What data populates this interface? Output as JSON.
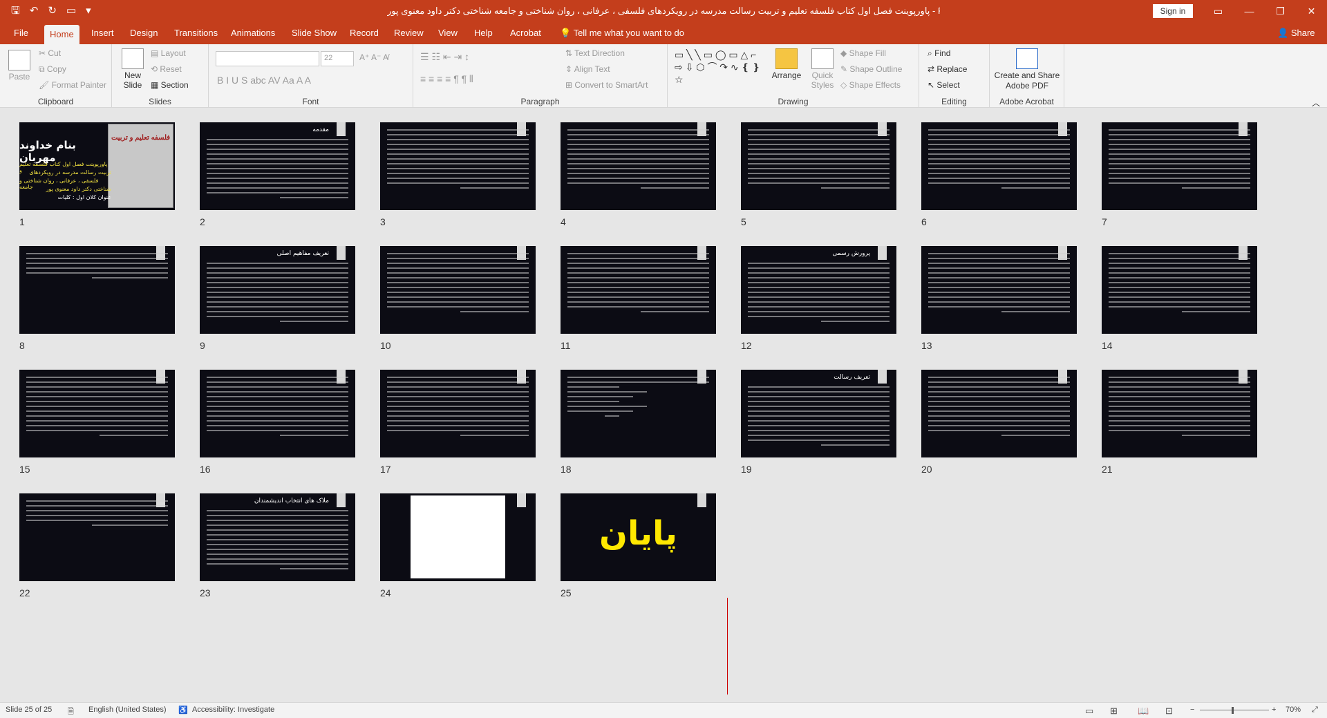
{
  "app": {
    "title": "پاورپوینت فصل اول کتاب فلسفه تعلیم و تربیت رسالت مدرسه در رویکردهای فلسفی ، عرفانی ، روان شناختی و جامعه شناختی دکتر داود معنوی پور  -  PowerPoint",
    "sign_in": "Sign in"
  },
  "menu": {
    "tabs": [
      "File",
      "Home",
      "Insert",
      "Design",
      "Transitions",
      "Animations",
      "Slide Show",
      "Record",
      "Review",
      "View",
      "Help",
      "Acrobat"
    ],
    "active": "Home",
    "tell_me": "Tell me what you want to do",
    "share": "Share"
  },
  "ribbon": {
    "clipboard": {
      "label": "Clipboard",
      "paste": "Paste",
      "cut": "Cut",
      "copy": "Copy",
      "format_painter": "Format Painter"
    },
    "slides": {
      "label": "Slides",
      "new_slide": "New Slide",
      "layout": "Layout",
      "reset": "Reset",
      "section": "Section"
    },
    "font": {
      "label": "Font",
      "size": "22"
    },
    "paragraph": {
      "label": "Paragraph",
      "text_direction": "Text Direction",
      "align_text": "Align Text",
      "convert_smartart": "Convert to SmartArt"
    },
    "drawing": {
      "label": "Drawing",
      "arrange": "Arrange",
      "quick_styles": "Quick Styles",
      "shape_fill": "Shape Fill",
      "shape_outline": "Shape Outline",
      "shape_effects": "Shape Effects"
    },
    "editing": {
      "label": "Editing",
      "find": "Find",
      "replace": "Replace",
      "select": "Select"
    },
    "acrobat": {
      "label": "Adobe Acrobat",
      "create_share": "Create and Share Adobe PDF"
    }
  },
  "slides": {
    "numbers": [
      "1",
      "2",
      "3",
      "4",
      "5",
      "6",
      "7",
      "8",
      "9",
      "10",
      "11",
      "12",
      "13",
      "14",
      "15",
      "16",
      "17",
      "18",
      "19",
      "20",
      "21",
      "22",
      "23",
      "24",
      "25"
    ],
    "titles": {
      "s2": "مقدمه",
      "s9": "تعریف مفاهیم اصلی",
      "s12": "پرورش رسمی",
      "s19": "تعریف رسالت",
      "s23": "ملاک های انتخاب اندیشمندان"
    },
    "cover": {
      "title": "بنام خداوند مهربان",
      "sub1": "پاورپوینت فصل اول کتاب فلسفه تعلیم و",
      "sub2": "تربیت رسالت مدرسه در رویکردهای",
      "sub3": "فلسفی ، عرفانی ، روان شناختی و جامعه",
      "sub4": "شناختی دکتر داود معنوی پور",
      "sub5": "عنوان کلان اول : کلیات",
      "book": "فلسفه تعلیم و تربیت"
    },
    "end_word": "پایان"
  },
  "status": {
    "slide": "Slide 25 of 25",
    "language": "English (United States)",
    "accessibility": "Accessibility: Investigate",
    "zoom": "70%"
  },
  "colors": {
    "accent": "#c43e1c",
    "slide_bg": "#0c0c14",
    "end_text": "#ffe800"
  }
}
